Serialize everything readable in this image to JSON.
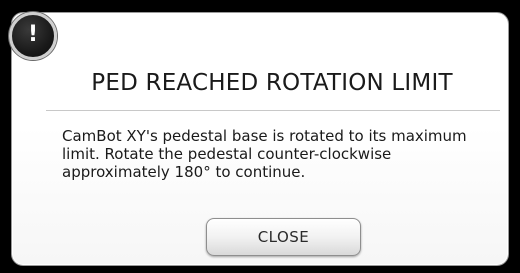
{
  "dialog": {
    "alert_icon": {
      "name": "exclamation-icon",
      "glyph": "!"
    },
    "title": "PED REACHED ROTATION LIMIT",
    "message_lines": [
      "CamBot XY's pedestal base is rotated to its maximum",
      "limit. Rotate the pedestal counter-clockwise",
      "approximately 180° to continue."
    ],
    "close_label": "CLOSE"
  },
  "colors": {
    "backdrop": "#000000",
    "dialog_background": "#ffffff",
    "text": "#1a1a1a",
    "badge": "#1a1a1a"
  }
}
